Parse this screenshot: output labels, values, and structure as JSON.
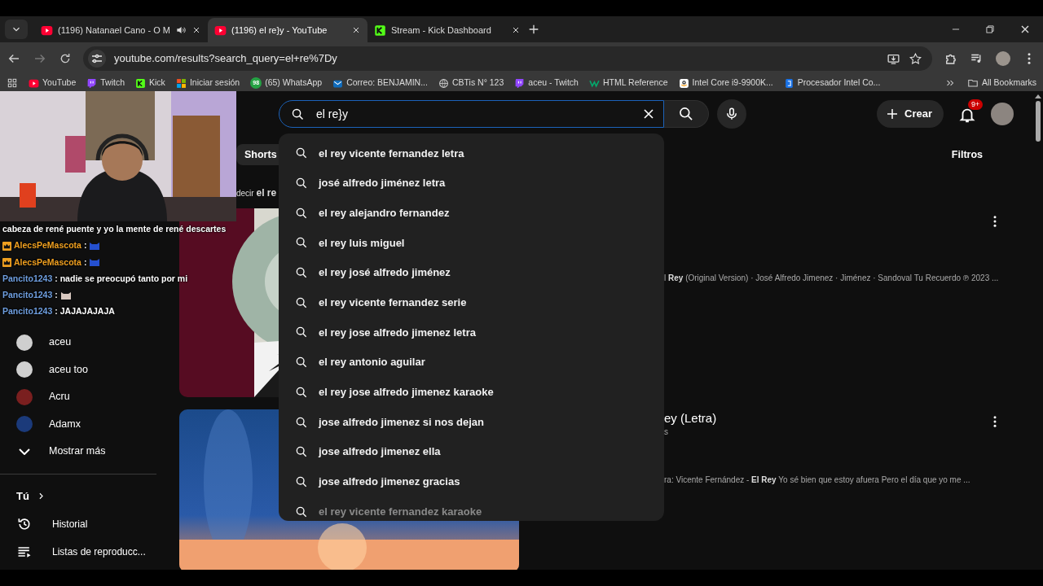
{
  "tabs": [
    {
      "title": "(1196) Natanael Cano - O M",
      "audio": true,
      "selected": false
    },
    {
      "title": "(1196) el re}y - YouTube",
      "audio": false,
      "selected": true
    },
    {
      "title": "Stream - Kick Dashboard",
      "audio": false,
      "selected": false
    }
  ],
  "address_bar": {
    "url": "youtube.com/results?search_query=el+re%7Dy"
  },
  "bookmarks": [
    {
      "label": "YouTube"
    },
    {
      "label": "Twitch"
    },
    {
      "label": "Kick"
    },
    {
      "label": "Iniciar sesión"
    },
    {
      "label": "(65) WhatsApp",
      "badge": "98"
    },
    {
      "label": "Correo: BENJAMIN..."
    },
    {
      "label": "CBTis N° 123"
    },
    {
      "label": "aceu - Twitch"
    },
    {
      "label": "HTML Reference"
    },
    {
      "label": "Intel Core i9-9900K..."
    },
    {
      "label": "Procesador Intel Co..."
    }
  ],
  "all_bookmarks": "All Bookmarks",
  "search": {
    "value": "el re}y",
    "suggestions": [
      "el rey vicente fernandez letra",
      "josé alfredo jiménez letra",
      "el rey alejandro fernandez",
      "el rey luis miguel",
      "el rey josé alfredo jiménez",
      "el rey vicente fernandez serie",
      "el rey jose alfredo jimenez letra",
      "el rey antonio aguilar",
      "el rey jose alfredo jimenez karaoke",
      "jose alfredo jimenez si nos dejan",
      "jose alfredo jimenez ella",
      "jose alfredo jimenez gracias",
      "el rey vicente fernandez karaoke"
    ]
  },
  "create_button": "Crear",
  "notifications_badge": "9+",
  "chip": "Shorts",
  "filters": "Filtros",
  "query_hint": "decir **el re**",
  "results": [
    {
      "snippet": "l **Rey** (Original Version) · José Alfredo Jimenez · Jiménez · Sandoval Tu Recuerdo ℗ 2023 ..."
    },
    {
      "title": "ey (Letra)",
      "meta": "s",
      "snippet": "ra: Vicente Fernández - **El Rey** Yo sé bien que estoy afuera Pero el día que yo me ..."
    }
  ],
  "sidebar": {
    "channels": [
      {
        "name": "aceu",
        "color": "#cfcfcf"
      },
      {
        "name": "aceu too",
        "color": "#cfcfcf"
      },
      {
        "name": "Acru",
        "color": "#7a1f1f"
      },
      {
        "name": "Adamx",
        "color": "#1b3a7a"
      }
    ],
    "show_more": "Mostrar más",
    "you": "Tú",
    "items": [
      {
        "label": "Historial"
      },
      {
        "label": "Listas de reproducc..."
      }
    ]
  },
  "chat": [
    {
      "message": "cabeza de rené puente y yo la mente de rené descartes",
      "crown_badge": false,
      "emote": false
    },
    {
      "user": "AlecsPeMascota",
      "color": "#f0a020",
      "message": ":",
      "crown_badge": true,
      "emote": true
    },
    {
      "user": "AlecsPeMascota",
      "color": "#f0a020",
      "message": ":",
      "crown_badge": true,
      "emote": true
    },
    {
      "user": "Pancito1243",
      "color": "#6f9fe0",
      "message": ": nadie se preocupó tanto por mi",
      "crown_badge": false,
      "emote": false
    },
    {
      "user": "Pancito1243",
      "color": "#6f9fe0",
      "message": ":",
      "crown_badge": false,
      "emote": true
    },
    {
      "user": "Pancito1243",
      "color": "#6f9fe0",
      "message": ": JAJAJAJAJA",
      "crown_badge": false,
      "emote": false
    }
  ]
}
